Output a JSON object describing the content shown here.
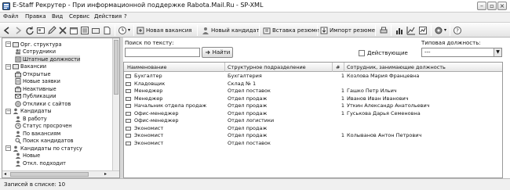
{
  "window": {
    "title": "E-Staff Рекрутер - При информационной поддержке Rabota.Mail.Ru - SP-XML"
  },
  "menu": [
    "Файл",
    "Правка",
    "Вид",
    "Сервис",
    "Действия",
    "?"
  ],
  "toolbar": {
    "new_vacancy": "Новая вакансия",
    "new_candidate": "Новый кандидат",
    "insert_resume": "Вставка резюме",
    "import_resume": "Импорт резюме"
  },
  "tree": [
    {
      "label": "Орг. структура",
      "toggle": "−",
      "icon": "folder-icon"
    },
    {
      "label": "Сотрудники",
      "toggle": "",
      "icon": "employees-icon"
    },
    {
      "label": "Штатные должности",
      "toggle": "",
      "icon": "positions-icon"
    },
    {
      "label": "Вакансии",
      "toggle": "−",
      "icon": "folder-icon"
    },
    {
      "label": "Открытые",
      "toggle": "",
      "icon": "vacancy-icon"
    },
    {
      "label": "Новые заявки",
      "toggle": "",
      "icon": "request-icon"
    },
    {
      "label": "Неактивные",
      "toggle": "",
      "icon": "vacancy-icon"
    },
    {
      "label": "Публикации",
      "toggle": "",
      "icon": "publication-icon"
    },
    {
      "label": "Отклики с сайтов",
      "toggle": "",
      "icon": "response-icon"
    },
    {
      "label": "Кандидаты",
      "toggle": "−",
      "icon": "person-icon"
    },
    {
      "label": "В работу",
      "toggle": "",
      "icon": "person-icon"
    },
    {
      "label": "Статус просрочен",
      "toggle": "",
      "icon": "clock-icon"
    },
    {
      "label": "По вакансиям",
      "toggle": "",
      "icon": "person-icon"
    },
    {
      "label": "Поиск кандидатов",
      "toggle": "",
      "icon": "search-icon"
    },
    {
      "label": "Кандидаты по статусу",
      "toggle": "−",
      "icon": "person-icon"
    },
    {
      "label": "Новые",
      "toggle": "",
      "icon": "person-icon"
    },
    {
      "label": "Откл. подходит",
      "toggle": "",
      "icon": "person-icon"
    }
  ],
  "filters": {
    "search_label": "Поиск по тексту:",
    "search_value": "",
    "find_label": "Найти",
    "active_label": "Действующие",
    "position_label": "Типовая должность:",
    "position_value": "---"
  },
  "grid": {
    "columns": [
      "Наименование",
      "Структурное подразделение",
      "#",
      "Сотрудник, занимающие должность"
    ],
    "rows": [
      [
        "Бухгалтер",
        "Бухгалтерия",
        "1",
        "Козлова Мария Францевна"
      ],
      [
        "Кладовщик",
        "Склад № 1",
        "",
        ""
      ],
      [
        "Менеджер",
        "Отдел поставок",
        "1",
        "Гашко Петр Ильич"
      ],
      [
        "Менеджер",
        "Отдел продаж",
        "1",
        "Иванов Иван Иванович"
      ],
      [
        "Начальник отдела продаж",
        "Отдел продаж",
        "1",
        "Уткин Александр Анатольевич"
      ],
      [
        "Офис-менеджер",
        "Отдел продаж",
        "1",
        "Гуськова Дарья Семеновна"
      ],
      [
        "Офис-менеджер",
        "Отдел логистики",
        "",
        ""
      ],
      [
        "Экономист",
        "Отдел продаж",
        "",
        ""
      ],
      [
        "Экономист",
        "Отдел продаж",
        "1",
        "Колыванов Антон Петрович"
      ],
      [
        "Экономист",
        "Отдел поставок",
        "",
        ""
      ]
    ]
  },
  "status": {
    "text": "Записей в списке: 10"
  }
}
